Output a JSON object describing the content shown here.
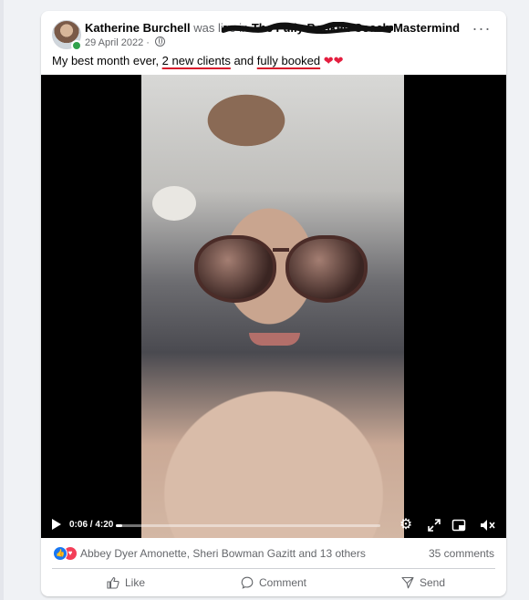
{
  "post": {
    "author": "Katherine Burchell",
    "was_live_in": "was live in",
    "group_name": "The Fully Booked Coach Mastermind",
    "date": "29 April 2022",
    "date_separator": "·",
    "more_glyph": "···",
    "text": {
      "part1": "My best month ever, ",
      "highlight1": "2 new clients",
      "part2": " and ",
      "highlight2": "fully booked",
      "hearts": " ❤❤"
    }
  },
  "video": {
    "time": "0:06 / 4:20",
    "progress_fraction": 0.023,
    "icons": [
      "play-icon",
      "settings-icon",
      "expand-icon",
      "picture-in-picture-icon",
      "mute-icon"
    ]
  },
  "engagement": {
    "reactors": "Abbey Dyer Amonette, Sheri Bowman Gazitt and 13 others",
    "comments": "35 comments",
    "reaction_icons": [
      "like-reaction-icon",
      "love-reaction-icon"
    ]
  },
  "actions": {
    "like": "Like",
    "comment": "Comment",
    "send": "Send"
  },
  "colors": {
    "link_blue": "#1877f2",
    "love_red": "#f33e58",
    "secondary_text": "#65676b",
    "underline_red": "#d81b2c"
  }
}
